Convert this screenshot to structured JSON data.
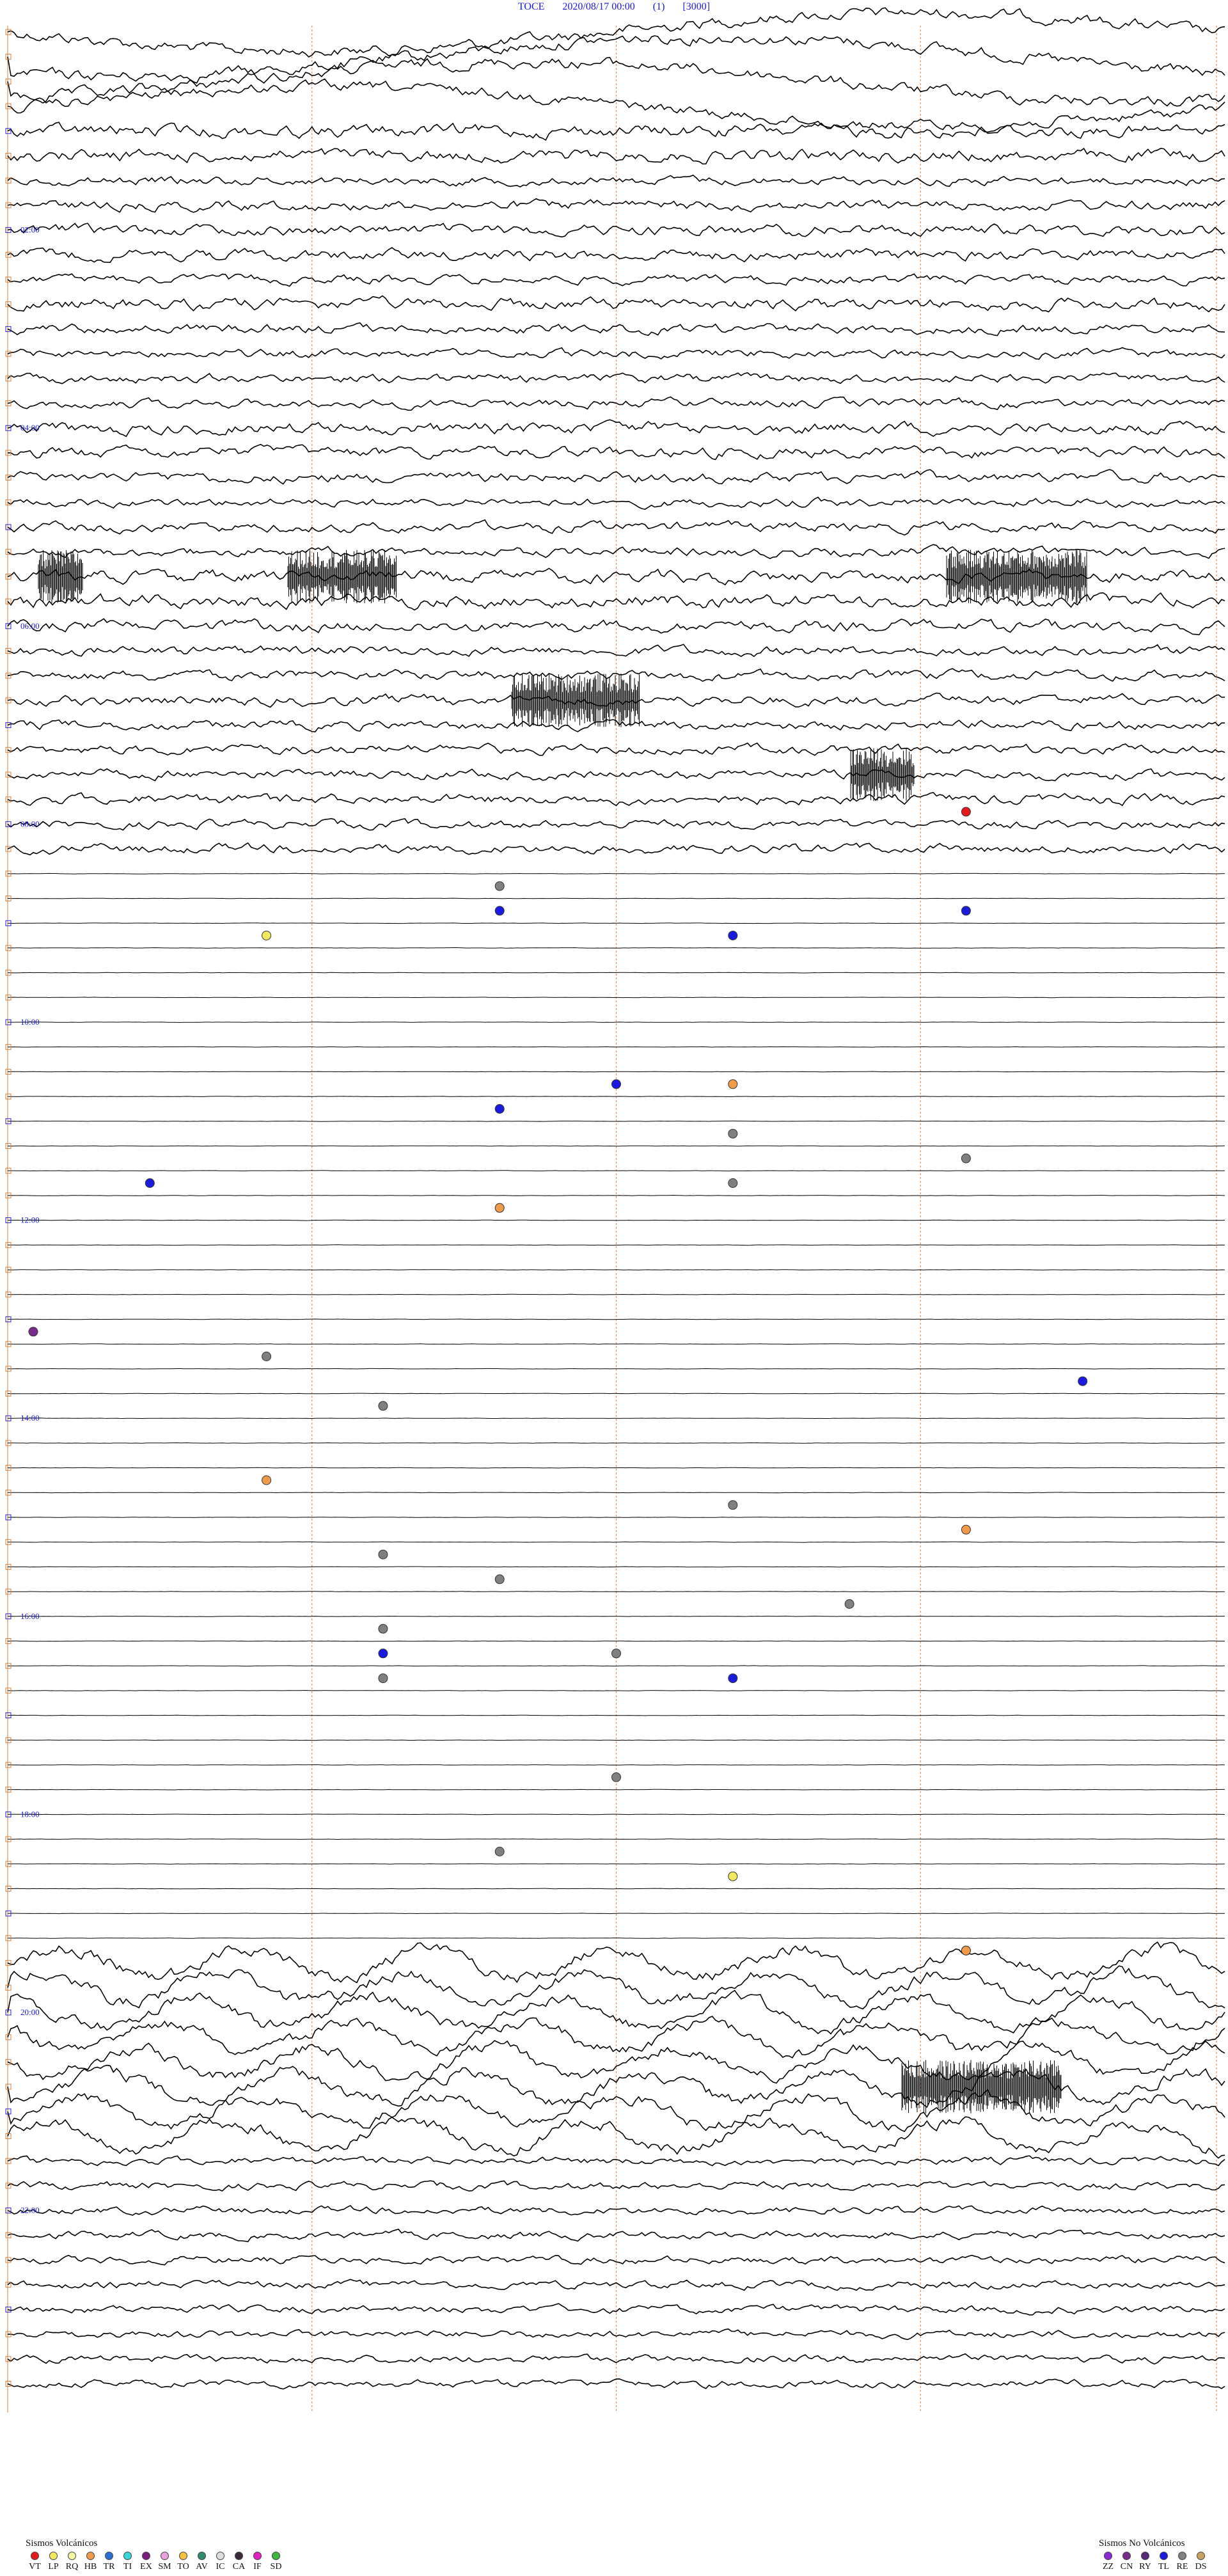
{
  "header": {
    "station": "TOCE",
    "datetime": "2020/08/17 00:00",
    "channel": "(1)",
    "scale": "[3000]"
  },
  "chart_data": {
    "type": "scatter",
    "description_kind": "helicorder",
    "time_labels": [
      {
        "row": 8,
        "label": "02:00"
      },
      {
        "row": 16,
        "label": "04:00"
      },
      {
        "row": 24,
        "label": "06:00"
      },
      {
        "row": 32,
        "label": "08:00"
      },
      {
        "row": 40,
        "label": "10:00"
      },
      {
        "row": 48,
        "label": "12:00"
      },
      {
        "row": 56,
        "label": "14:00"
      },
      {
        "row": 64,
        "label": "16:00"
      },
      {
        "row": 72,
        "label": "18:00"
      },
      {
        "row": 80,
        "label": "20:00"
      },
      {
        "row": 88,
        "label": "22:00"
      }
    ],
    "minute_gridlines": [
      15,
      30,
      45,
      60
    ],
    "rows_per_hour": 4,
    "total_rows": 96,
    "events": [
      {
        "t": 34.4,
        "cls": "RE",
        "off": 0
      },
      {
        "t": 31.8,
        "cls": "VT",
        "off": 0
      },
      {
        "t": 35.4,
        "cls": "TL",
        "off": 0
      },
      {
        "t": 35.8,
        "cls": "TL",
        "off": 0
      },
      {
        "t": 36.6,
        "cls": "TL",
        "off": 0
      },
      {
        "t": 36.2,
        "cls": "LP",
        "off": 0
      },
      {
        "t": 42.5,
        "cls": "TL",
        "off": 0
      },
      {
        "t": 43.4,
        "cls": "TL",
        "off": 0
      },
      {
        "t": 42.6,
        "cls": "HB",
        "off": 0
      },
      {
        "t": 44.6,
        "cls": "RE",
        "off": 0
      },
      {
        "t": 45.8,
        "cls": "RE",
        "off": 0
      },
      {
        "t": 46.1,
        "cls": "TL",
        "off": 0
      },
      {
        "t": 46.6,
        "cls": "RE",
        "off": 0
      },
      {
        "t": 47.4,
        "cls": "HB",
        "off": 0
      },
      {
        "t": 53.2,
        "cls": "RE",
        "off": 0
      },
      {
        "t": 52.0,
        "cls": "CN",
        "off": 0
      },
      {
        "t": 54.9,
        "cls": "TL",
        "off": 0
      },
      {
        "t": 55.3,
        "cls": "RE",
        "off": 0
      },
      {
        "t": 58.2,
        "cls": "HB",
        "off": 0
      },
      {
        "t": 59.6,
        "cls": "RE",
        "off": 0
      },
      {
        "t": 60.8,
        "cls": "HB",
        "off": 0
      },
      {
        "t": 61.3,
        "cls": "RE",
        "off": 0
      },
      {
        "t": 62.4,
        "cls": "RE",
        "off": 0
      },
      {
        "t": 63.7,
        "cls": "RE",
        "off": 0
      },
      {
        "t": 64.3,
        "cls": "RE",
        "off": 0
      },
      {
        "t": 65.5,
        "cls": "RE",
        "off": 0
      },
      {
        "t": 65.3,
        "cls": "TL",
        "off": 0
      },
      {
        "t": 66.3,
        "cls": "RE",
        "off": 0
      },
      {
        "t": 66.6,
        "cls": "TL",
        "off": 0
      },
      {
        "t": 70.5,
        "cls": "RE",
        "off": 0
      },
      {
        "t": 73.4,
        "cls": "RE",
        "off": 0
      },
      {
        "t": 74.6,
        "cls": "LP",
        "off": 0
      },
      {
        "t": 77.8,
        "cls": "RE",
        "off": 0
      },
      {
        "t": 77.8,
        "cls": "HB",
        "off": 0
      }
    ]
  },
  "legend_volcanic": {
    "title": "Sismos Volcánicos",
    "items": [
      {
        "code": "VT",
        "color": "#e41a1c"
      },
      {
        "code": "LP",
        "color": "#f2e85c"
      },
      {
        "code": "RQ",
        "color": "#f5f5a0"
      },
      {
        "code": "HB",
        "color": "#f09a4a"
      },
      {
        "code": "TR",
        "color": "#2b6fd6"
      },
      {
        "code": "TI",
        "color": "#38d6d6"
      },
      {
        "code": "EX",
        "color": "#7a1a7a"
      },
      {
        "code": "SM",
        "color": "#e8a0e0"
      },
      {
        "code": "TO",
        "color": "#f4c040"
      },
      {
        "code": "AV",
        "color": "#2f8a6a"
      },
      {
        "code": "IC",
        "color": "#dddddd"
      },
      {
        "code": "CA",
        "color": "#3a2a3a"
      },
      {
        "code": "IF",
        "color": "#e020c0"
      },
      {
        "code": "SD",
        "color": "#3cb83c"
      }
    ]
  },
  "legend_nonvolcanic": {
    "title": "Sismos No Volcánicos",
    "items": [
      {
        "code": "ZZ",
        "color": "#8a2ad6"
      },
      {
        "code": "CN",
        "color": "#7a2a8a"
      },
      {
        "code": "RY",
        "color": "#5a2a7a"
      },
      {
        "code": "TL",
        "color": "#1a1ae0"
      },
      {
        "code": "RE",
        "color": "#808080"
      },
      {
        "code": "DS",
        "color": "#c8a060"
      }
    ]
  }
}
